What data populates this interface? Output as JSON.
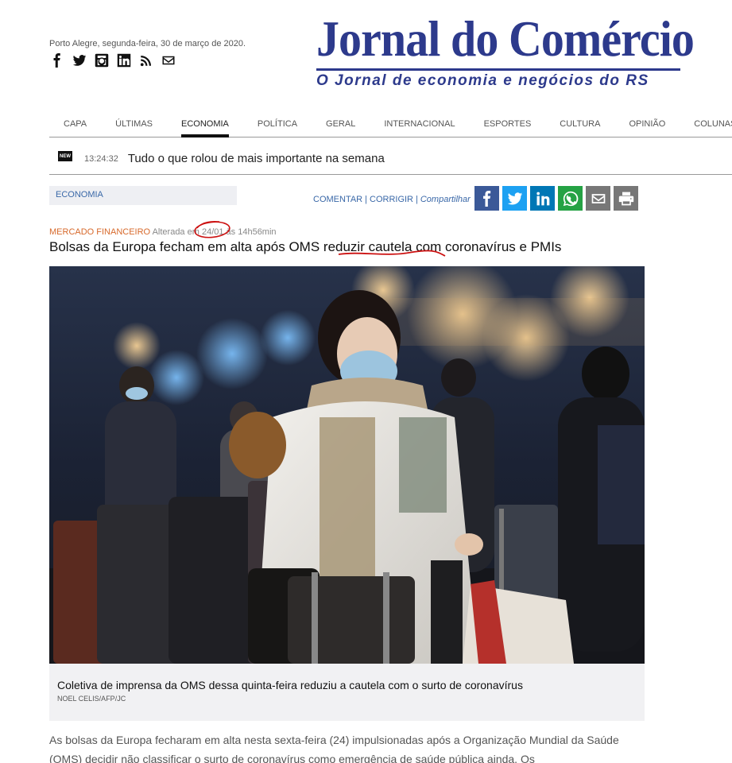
{
  "header": {
    "date_line": "Porto Alegre, segunda-feira, 30 de março de 2020.",
    "social_icons": [
      "facebook-icon",
      "twitter-icon",
      "instagram-icon",
      "linkedin-icon",
      "rss-icon",
      "mail-icon"
    ],
    "logo_title": "Jornal do Comércio",
    "logo_subtitle": "O Jornal de economia e negócios do RS",
    "brand_color": "#2d3a8c"
  },
  "nav": {
    "items": [
      "CAPA",
      "ÚLTIMAS",
      "ECONOMIA",
      "POLÍTICA",
      "GERAL",
      "INTERNACIONAL",
      "ESPORTES",
      "CULTURA",
      "OPINIÃO",
      "COLUNAS"
    ],
    "active": "ECONOMIA"
  },
  "ticker": {
    "badge": "NEW",
    "time": "13:24:32",
    "text": "Tudo o que rolou de mais importante na semana"
  },
  "section": {
    "label": "ECONOMIA"
  },
  "actions": {
    "comment": "COMENTAR",
    "sep": "|",
    "correct": "CORRIGIR",
    "share": "Compartilhar",
    "share_icons": [
      {
        "name": "facebook-share-icon",
        "color": "#3b5998"
      },
      {
        "name": "twitter-share-icon",
        "color": "#1da1f2"
      },
      {
        "name": "linkedin-share-icon",
        "color": "#0077b5"
      },
      {
        "name": "whatsapp-share-icon",
        "color": "#25a244"
      },
      {
        "name": "email-share-icon",
        "color": "#777777"
      },
      {
        "name": "print-share-icon",
        "color": "#777777"
      }
    ]
  },
  "article": {
    "category": "MERCADO FINANCEIRO",
    "altered_prefix": "Alterada em",
    "altered_date": "24/01",
    "altered_suffix": "às 14h56min",
    "headline_a": "Bolsas da Europa fecham em alta após OMS ",
    "headline_b": "reduzir cautela",
    "headline_c": " com coronavírus e PMIs",
    "caption": "Coletiva de imprensa da OMS dessa quinta-feira reduziu a cautela com o surto de coronavírus",
    "credit": "NOEL CELIS/AFP/JC",
    "body": "As bolsas da Europa fecharam em alta nesta sexta-feira (24) impulsionadas após a Organização Mundial da Saúde (OMS) decidir não classificar o surto de coronavírus como emergência de saúde pública ainda. Os"
  },
  "annotation_color": "#cc1111"
}
